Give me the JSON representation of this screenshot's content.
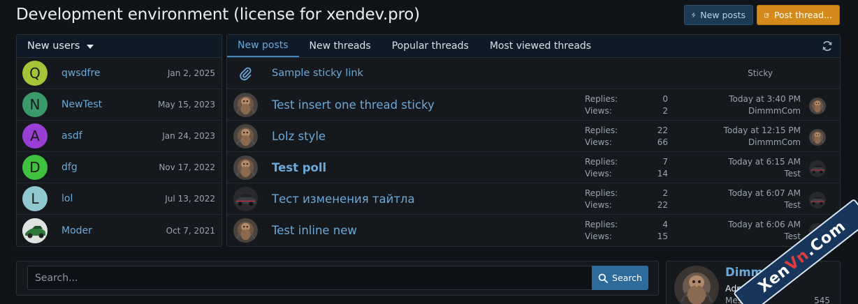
{
  "page": {
    "title": "Development environment (license for xendev.pro)"
  },
  "actions": {
    "new_posts": "New posts",
    "post_thread": "Post thread..."
  },
  "users": {
    "header": "New users",
    "items": [
      {
        "initial": "Q",
        "name": "qwsdfre",
        "date": "Jan 2, 2025",
        "color": "#a6c438"
      },
      {
        "initial": "N",
        "name": "NewTest",
        "date": "May 15, 2023",
        "color": "#3a9a6a"
      },
      {
        "initial": "A",
        "name": "asdf",
        "date": "Jan 24, 2023",
        "color": "#9a3fd6"
      },
      {
        "initial": "D",
        "name": "dfg",
        "date": "Nov 17, 2022",
        "color": "#3fc23f"
      },
      {
        "initial": "L",
        "name": "lol",
        "date": "Jul 13, 2022",
        "color": "#8fc9cf"
      },
      {
        "initial": "",
        "name": "Moder",
        "date": "Oct 7, 2021",
        "color": "#d8dcd8"
      }
    ]
  },
  "threads": {
    "tabs": [
      "New posts",
      "New threads",
      "Popular threads",
      "Most viewed threads"
    ],
    "replies_label": "Replies:",
    "views_label": "Views:",
    "sticky": {
      "title": "Sample sticky link",
      "label": "Sticky"
    },
    "items": [
      {
        "title": "Test insert one thread sticky",
        "replies": "0",
        "views": "2",
        "time": "Today at 3:40 PM",
        "user": "DimmmCom",
        "bold": false
      },
      {
        "title": "Lolz style",
        "replies": "22",
        "views": "66",
        "time": "Today at 12:15 PM",
        "user": "DimmmCom",
        "bold": false
      },
      {
        "title": "Test poll",
        "replies": "7",
        "views": "14",
        "time": "Today at 6:15 AM",
        "user": "Test",
        "bold": true
      },
      {
        "title": "Тест изменения тайтла",
        "replies": "2",
        "views": "22",
        "time": "Today at 6:07 AM",
        "user": "Test",
        "bold": false
      },
      {
        "title": "Test inline new",
        "replies": "4",
        "views": "15",
        "time": "Today at 6:06 AM",
        "user": "Test",
        "bold": false
      }
    ]
  },
  "search": {
    "placeholder": "Search...",
    "button": "Search"
  },
  "profile": {
    "name": "Dimmm",
    "role": "Admini",
    "messages_label": "Mes",
    "messages_count": "545"
  },
  "watermark": {
    "text_a": "Xen",
    "text_b": "Vn",
    "text_c": ".Com"
  },
  "colors": {
    "accent_link": "#6aa9d8",
    "post_thread_button": "#d48a1b",
    "header_bg": "#0e1a26"
  }
}
